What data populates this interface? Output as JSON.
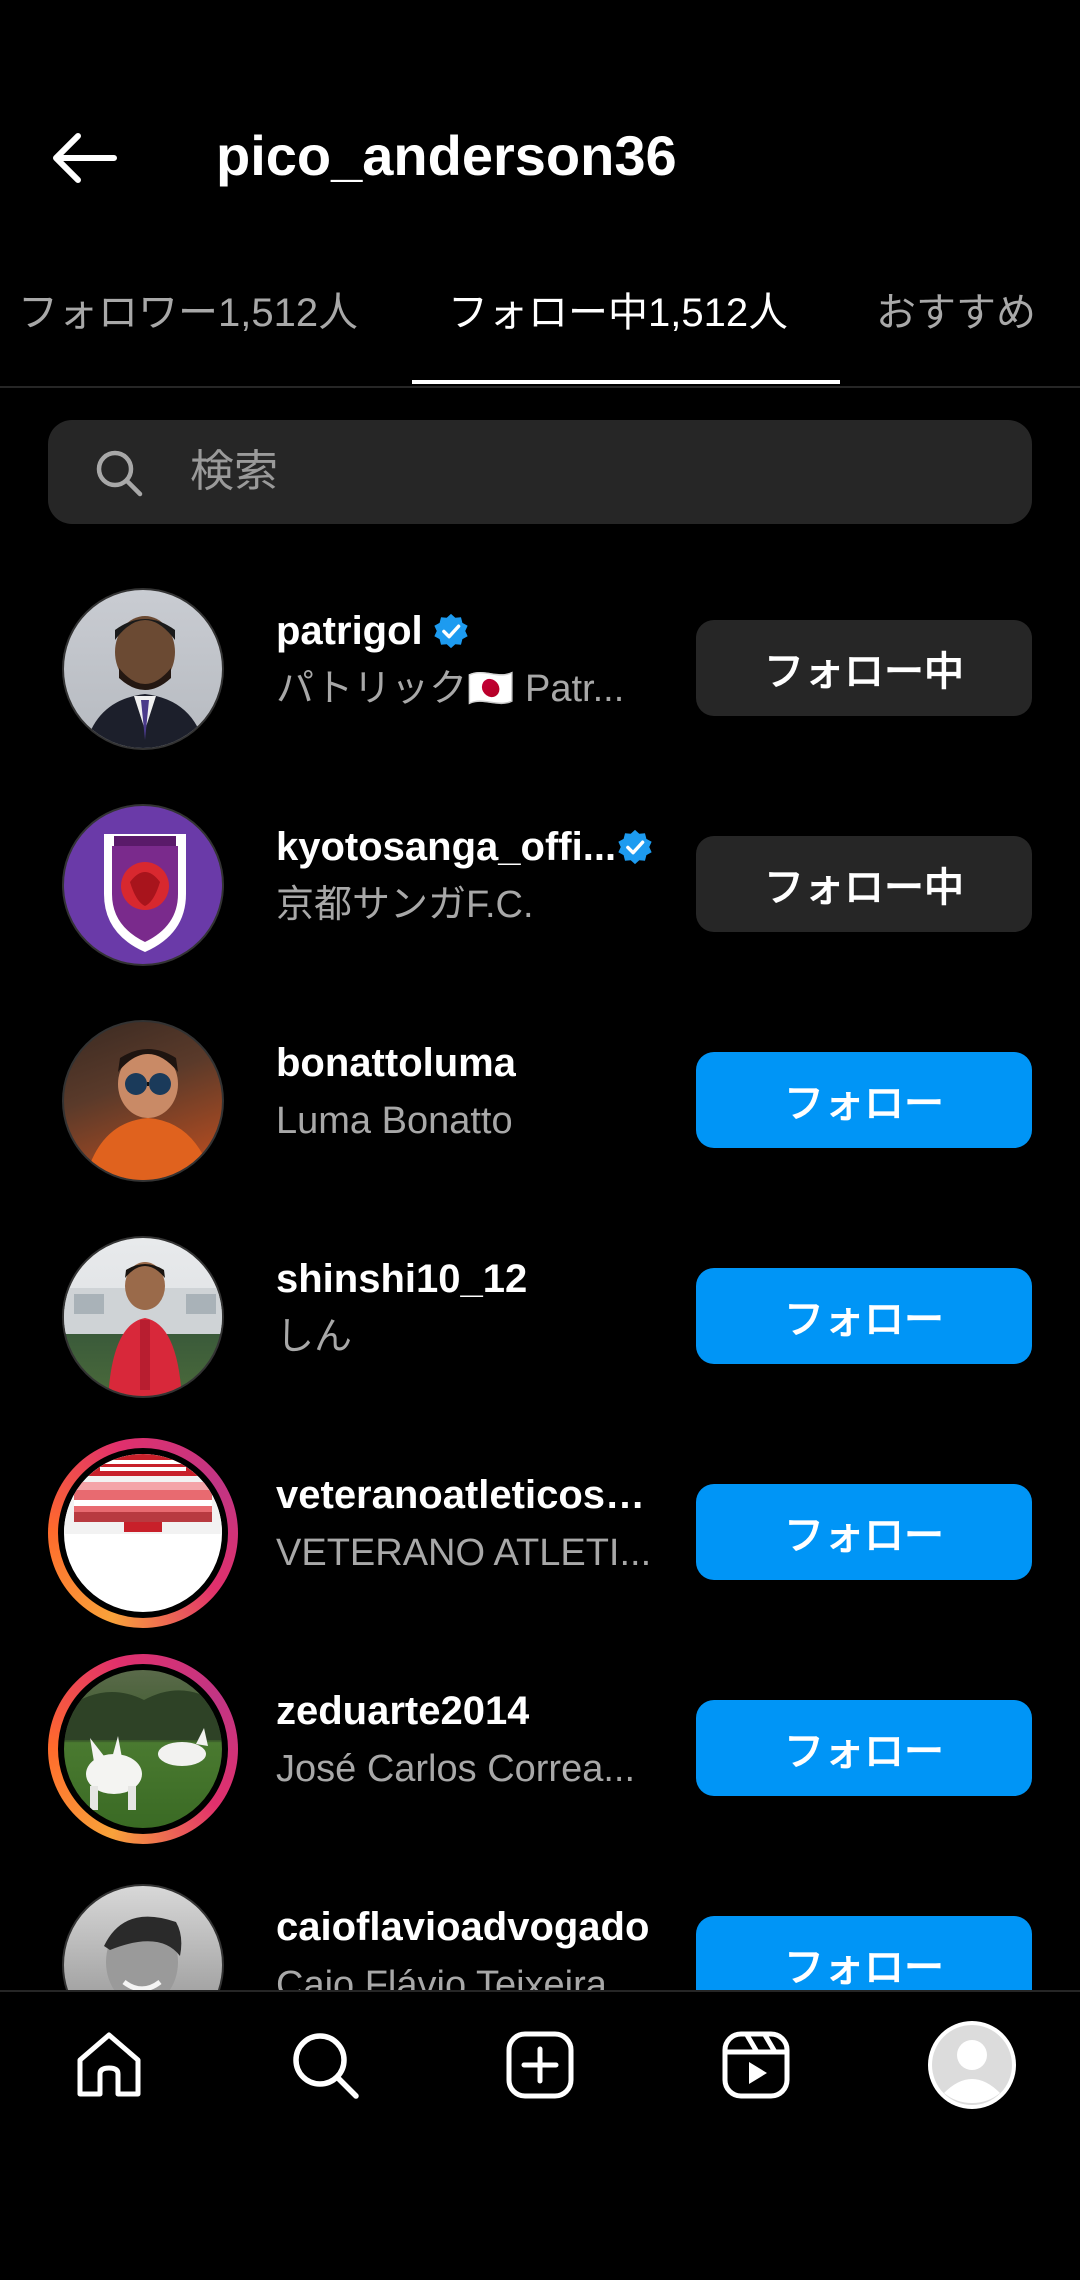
{
  "header": {
    "title": "pico_anderson36",
    "back_icon": "arrow-left-icon"
  },
  "tabs": [
    {
      "label": "フォロワー1,512人",
      "active": false
    },
    {
      "label": "フォロー中1,512人",
      "active": true
    },
    {
      "label": "おすすめ",
      "active": false
    }
  ],
  "search": {
    "placeholder": "検索",
    "value": ""
  },
  "accounts": [
    {
      "username": "patrigol",
      "verified": true,
      "name": "パトリック🇯🇵 Patr...",
      "button": "フォロー中",
      "state": "following",
      "story": false
    },
    {
      "username": "kyotosanga_offi...",
      "verified": true,
      "name": "京都サンガF.C.",
      "button": "フォロー中",
      "state": "following",
      "story": false
    },
    {
      "username": "bonattoluma",
      "verified": false,
      "name": "Luma Bonatto",
      "button": "フォロー",
      "state": "follow",
      "story": false
    },
    {
      "username": "shinshi10_12",
      "verified": false,
      "name": "しん",
      "button": "フォロー",
      "state": "follow",
      "story": false
    },
    {
      "username": "veteranoatleticosa...",
      "verified": false,
      "name": "VETERANO ATLETI...",
      "button": "フォロー",
      "state": "follow",
      "story": true
    },
    {
      "username": "zeduarte2014",
      "verified": false,
      "name": "José Carlos Correa...",
      "button": "フォロー",
      "state": "follow",
      "story": true
    },
    {
      "username": "caioflavioadvogado",
      "verified": false,
      "name": "Caio Flávio Teixeira...",
      "button": "フォロー",
      "state": "follow",
      "story": false
    }
  ],
  "bottom_nav": [
    {
      "icon": "home-icon"
    },
    {
      "icon": "search-icon"
    },
    {
      "icon": "create-post-icon"
    },
    {
      "icon": "reels-icon"
    },
    {
      "icon": "profile-avatar-icon"
    }
  ],
  "colors": {
    "background": "#000000",
    "follow_button": "#0095f6",
    "following_button": "#262626",
    "verified_badge": "#1d9bf0",
    "secondary_text": "#a8a8a8"
  }
}
